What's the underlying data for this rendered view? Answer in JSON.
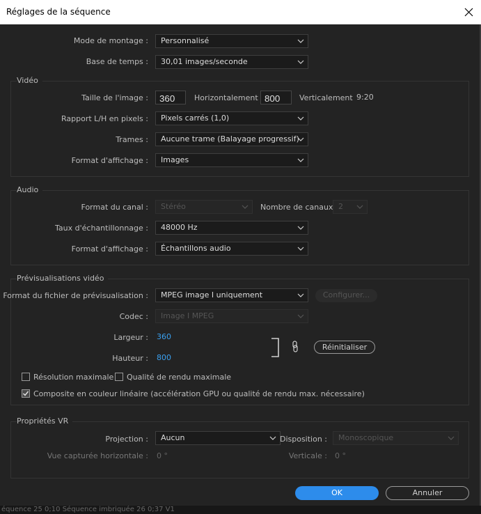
{
  "window": {
    "title": "Réglages de la séquence"
  },
  "general": {
    "mode_label": "Mode de montage :",
    "mode_value": "Personnalisé",
    "timebase_label": "Base de temps :",
    "timebase_value": "30,01  images/seconde"
  },
  "video": {
    "group_title": "Vidéo",
    "frame_size_label": "Taille de l'image :",
    "width_value": "360",
    "horizontal_label": "Horizontalement",
    "height_value": "800",
    "vertical_label": "Verticalement",
    "aspect_ratio": "9:20",
    "pixel_ratio_label": "Rapport L/H en pixels :",
    "pixel_ratio_value": "Pixels carrés (1,0)",
    "fields_label": "Trames :",
    "fields_value": "Aucune trame (Balayage progressif)",
    "display_label": "Format d'affichage :",
    "display_value": "Images"
  },
  "audio": {
    "group_title": "Audio",
    "channel_format_label": "Format du canal :",
    "channel_format_value": "Stéréo",
    "channels_label": "Nombre de canaux :",
    "channels_value": "2",
    "sample_rate_label": "Taux d'échantillonnage :",
    "sample_rate_value": "48000 Hz",
    "display_label": "Format d'affichage :",
    "display_value": "Échantillons audio"
  },
  "preview": {
    "group_title": "Prévisualisations vidéo",
    "file_format_label": "Format du fichier de prévisualisation :",
    "file_format_value": "MPEG image I uniquement",
    "configure_label": "Configurer...",
    "codec_label": "Codec :",
    "codec_value": "Image I MPEG",
    "width_label": "Largeur :",
    "width_value": "360",
    "height_label": "Hauteur :",
    "height_value": "800",
    "reset_label": "Réinitialiser",
    "max_resolution_label": "Résolution maximale",
    "max_resolution_checked": false,
    "max_quality_label": "Qualité de rendu maximale",
    "max_quality_checked": false,
    "linear_color_label": "Composite en couleur linéaire (accélération GPU ou qualité de rendu max. nécessaire)",
    "linear_color_checked": true
  },
  "vr": {
    "group_title": "Propriétés VR",
    "projection_label": "Projection :",
    "projection_value": "Aucun",
    "layout_label": "Disposition :",
    "layout_value": "Monoscopique",
    "h_view_label": "Vue capturée horizontale :",
    "h_view_value": "0 °",
    "vertical_label": "Verticale :",
    "vertical_value": "0 °"
  },
  "buttons": {
    "ok_label": "OK",
    "cancel_label": "Annuler"
  },
  "footer": {
    "text": "équence 25        0;10     Séquence imbriquée 26        0;37                          V1"
  },
  "colors": {
    "accent": "#2d8ceb",
    "link_value": "#3aa0f0",
    "dialog_bg": "#232323"
  }
}
